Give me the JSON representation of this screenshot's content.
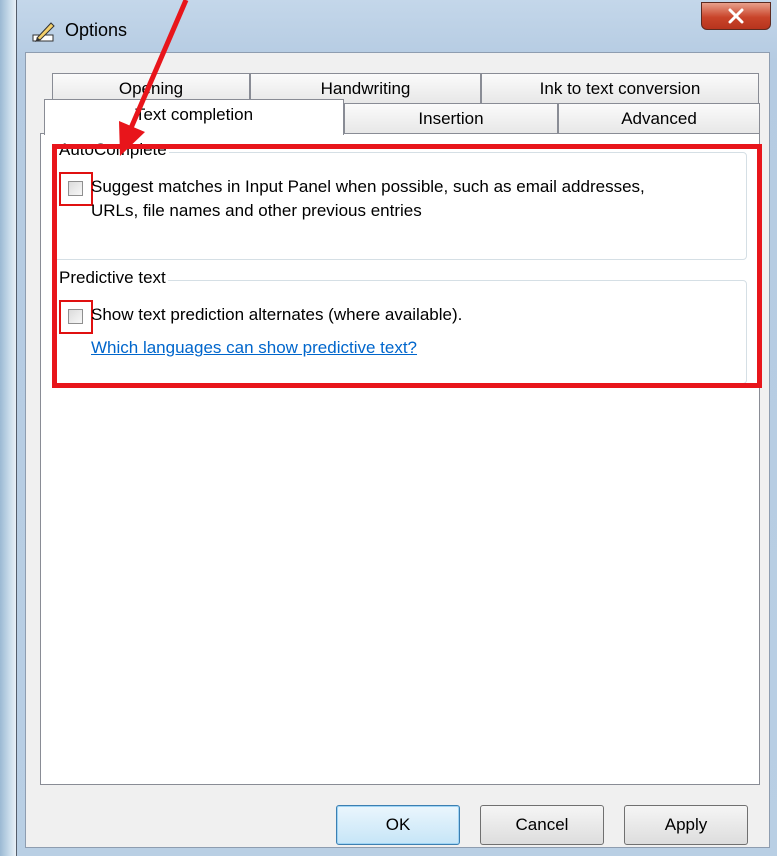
{
  "window": {
    "title": "Options"
  },
  "tabs": {
    "back_row": [
      {
        "label": "Opening"
      },
      {
        "label": "Handwriting"
      },
      {
        "label": "Ink to text conversion"
      }
    ],
    "front_row": [
      {
        "label": "Text completion",
        "selected": true
      },
      {
        "label": "Insertion"
      },
      {
        "label": "Advanced"
      }
    ]
  },
  "autocomplete": {
    "legend": "AutoComplete",
    "option_line1": "Suggest matches in Input Panel when possible, such as email addresses,",
    "option_line2": "URLs, file names and other previous entries",
    "checked": false
  },
  "predictive": {
    "legend": "Predictive text",
    "option": "Show text prediction alternates (where available).",
    "checked": false,
    "link": "Which languages can show predictive text?"
  },
  "buttons": {
    "ok": "OK",
    "cancel": "Cancel",
    "apply": "Apply"
  },
  "colors": {
    "highlight": "#e8151b",
    "link": "#0066cc"
  }
}
